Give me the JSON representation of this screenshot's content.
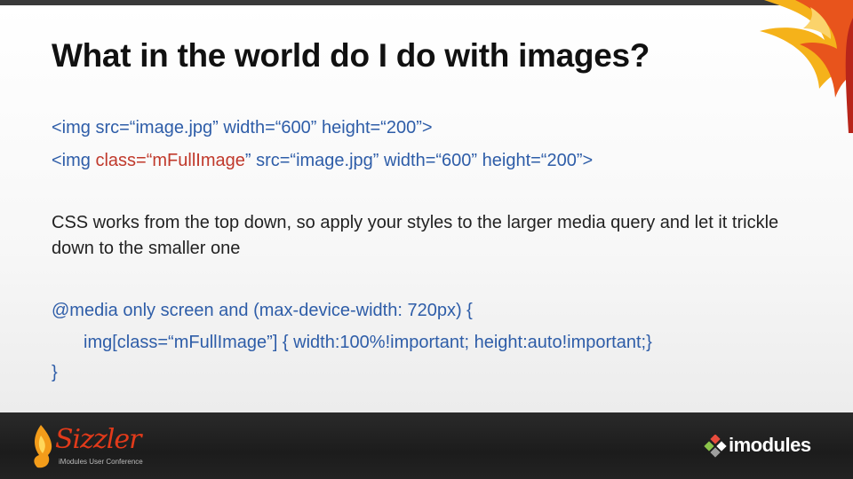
{
  "slide": {
    "title": "What in the world do I do with images?",
    "code1": "<img src=“image.jpg” width=“600” height=“200”>",
    "code2": {
      "prefix": "<img ",
      "attr": "class=“mFullImage",
      "suffix": "” src=“image.jpg” width=“600” height=“200”>"
    },
    "paragraph": "CSS works from the top down, so apply your styles to the larger media query and let it trickle down to the smaller one",
    "media": {
      "line1": "@media only screen and (max-device-width: 720px) {",
      "line2": "img[class=“mFullImage”] { width:100%!important; height:auto!important;}",
      "line3": "}"
    }
  },
  "footer": {
    "sizzler_logo_text": "Sizzler",
    "sizzler_subtitle": "iModules User Conference",
    "imodules_logo_text": "imodules"
  },
  "colors": {
    "code": "#2e5da8",
    "attribute": "#c0392b",
    "footer": "#222222",
    "flame": "#e8541c"
  },
  "icons": [
    "flame-decoration-icon",
    "sizzler-flame-icon",
    "imodules-cube-icon"
  ]
}
